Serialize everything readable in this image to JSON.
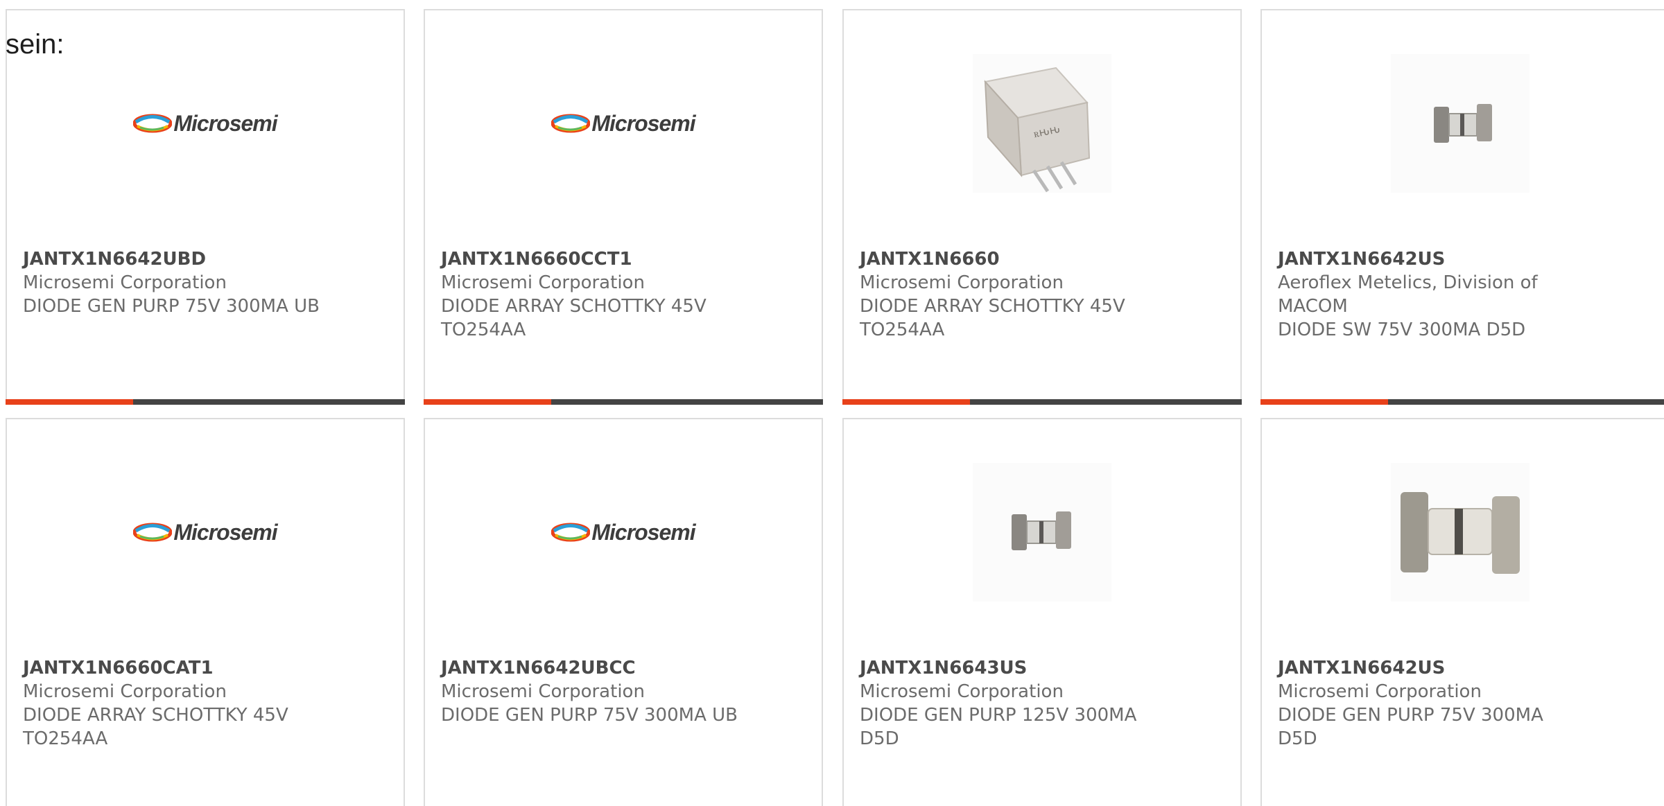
{
  "intro_text": "sein:",
  "colors": {
    "accent": "#e8411a",
    "bar": "#444444",
    "border": "#dcdcdc"
  },
  "products": [
    {
      "part": "JANTX1N6642UBD",
      "manufacturer": "Microsemi Corporation",
      "description": "DIODE GEN PURP 75V 300MA UB",
      "image": "microsemi-logo",
      "logo_text": "Microsemi"
    },
    {
      "part": "JANTX1N6660CCT1",
      "manufacturer": "Microsemi Corporation",
      "description": "DIODE ARRAY SCHOTTKY 45V TO254AA",
      "image": "microsemi-logo",
      "logo_text": "Microsemi"
    },
    {
      "part": "JANTX1N6660",
      "manufacturer": "Microsemi Corporation",
      "description": "DIODE ARRAY SCHOTTKY 45V TO254AA",
      "image": "to254-package-photo"
    },
    {
      "part": "JANTX1N6642US",
      "manufacturer": "Aeroflex Metelics, Division of MACOM",
      "description": "DIODE SW 75V 300MA D5D",
      "image": "d5d-diode-photo-small"
    },
    {
      "part": "JANTX1N6660CAT1",
      "manufacturer": "Microsemi Corporation",
      "description": "DIODE ARRAY SCHOTTKY 45V TO254AA",
      "image": "microsemi-logo",
      "logo_text": "Microsemi"
    },
    {
      "part": "JANTX1N6642UBCC",
      "manufacturer": "Microsemi Corporation",
      "description": "DIODE GEN PURP 75V 300MA UB",
      "image": "microsemi-logo",
      "logo_text": "Microsemi"
    },
    {
      "part": "JANTX1N6643US",
      "manufacturer": "Microsemi Corporation",
      "description": "DIODE GEN PURP 125V 300MA D5D",
      "image": "d5d-diode-photo-small"
    },
    {
      "part": "JANTX1N6642US",
      "manufacturer": "Microsemi Corporation",
      "description": "DIODE GEN PURP 75V 300MA D5D",
      "image": "d5d-diode-photo-large"
    }
  ]
}
